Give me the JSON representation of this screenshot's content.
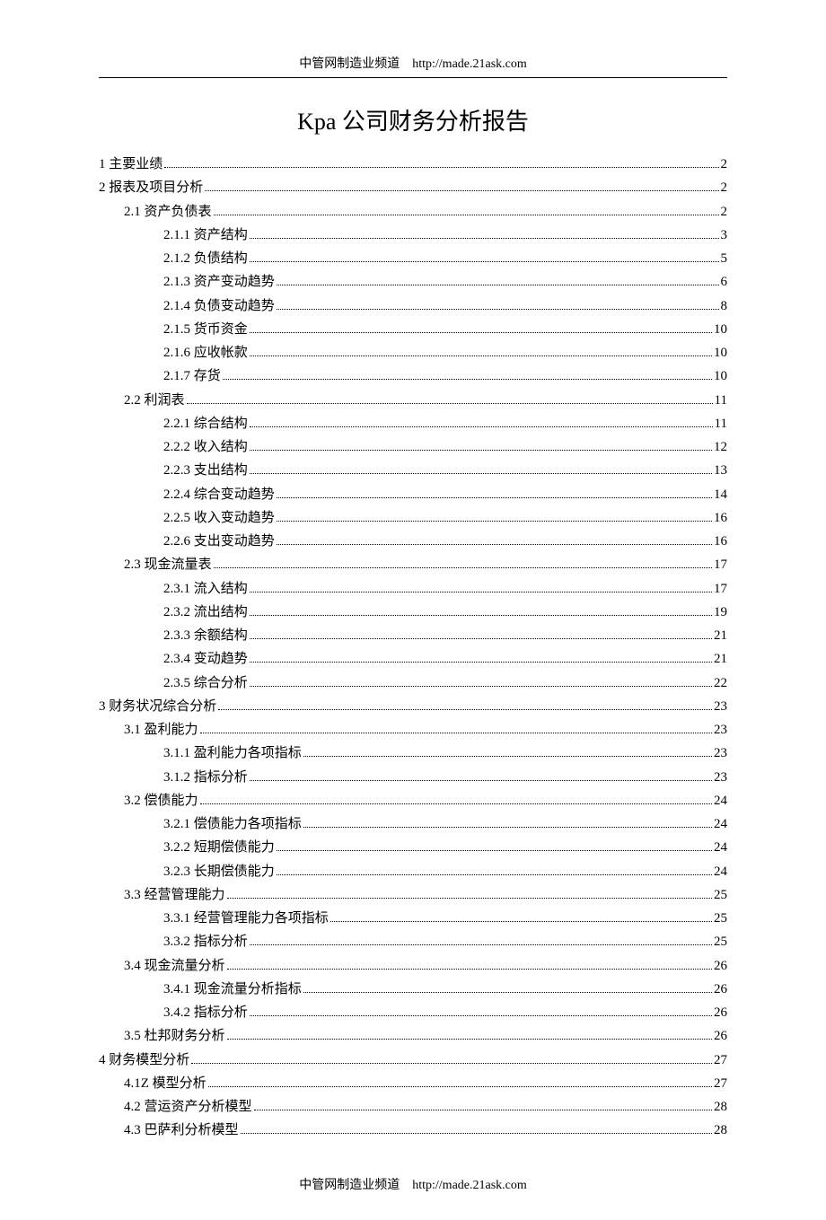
{
  "header": {
    "site_name": "中管网制造业频道",
    "url": "http://made.21ask.com"
  },
  "title": "Kpa 公司财务分析报告",
  "footer": {
    "site_name": "中管网制造业频道",
    "url": "http://made.21ask.com"
  },
  "toc": [
    {
      "label": "1 主要业绩",
      "page": "2",
      "indent": 0
    },
    {
      "label": "2 报表及项目分析",
      "page": "2",
      "indent": 0
    },
    {
      "label": "2.1 资产负债表",
      "page": "2",
      "indent": 1
    },
    {
      "label": "2.1.1 资产结构",
      "page": "3",
      "indent": 2
    },
    {
      "label": "2.1.2 负债结构",
      "page": "5",
      "indent": 2
    },
    {
      "label": "2.1.3 资产变动趋势",
      "page": "6",
      "indent": 2
    },
    {
      "label": "2.1.4 负债变动趋势",
      "page": "8",
      "indent": 2
    },
    {
      "label": "2.1.5 货币资金",
      "page": "10",
      "indent": 2
    },
    {
      "label": "2.1.6 应收帐款",
      "page": "10",
      "indent": 2
    },
    {
      "label": "2.1.7 存货",
      "page": "10",
      "indent": 2
    },
    {
      "label": "2.2 利润表",
      "page": "11",
      "indent": 1
    },
    {
      "label": "2.2.1 综合结构",
      "page": "11",
      "indent": 2
    },
    {
      "label": "2.2.2 收入结构",
      "page": "12",
      "indent": 2
    },
    {
      "label": "2.2.3 支出结构",
      "page": "13",
      "indent": 2
    },
    {
      "label": "2.2.4 综合变动趋势",
      "page": "14",
      "indent": 2
    },
    {
      "label": "2.2.5 收入变动趋势",
      "page": "16",
      "indent": 2
    },
    {
      "label": "2.2.6 支出变动趋势",
      "page": "16",
      "indent": 2
    },
    {
      "label": "2.3 现金流量表",
      "page": "17",
      "indent": 1
    },
    {
      "label": "2.3.1 流入结构",
      "page": "17",
      "indent": 2
    },
    {
      "label": "2.3.2 流出结构",
      "page": "19",
      "indent": 2
    },
    {
      "label": "2.3.3 余额结构",
      "page": "21",
      "indent": 2
    },
    {
      "label": "2.3.4 变动趋势",
      "page": "21",
      "indent": 2
    },
    {
      "label": "2.3.5 综合分析",
      "page": "22",
      "indent": 2
    },
    {
      "label": "3 财务状况综合分析",
      "page": "23",
      "indent": 0
    },
    {
      "label": "3.1 盈利能力",
      "page": "23",
      "indent": 1
    },
    {
      "label": "3.1.1 盈利能力各项指标",
      "page": "23",
      "indent": 2
    },
    {
      "label": "3.1.2 指标分析",
      "page": "23",
      "indent": 2
    },
    {
      "label": "3.2 偿债能力",
      "page": "24",
      "indent": 1
    },
    {
      "label": "3.2.1 偿债能力各项指标",
      "page": "24",
      "indent": 2
    },
    {
      "label": "3.2.2 短期偿债能力",
      "page": "24",
      "indent": 2
    },
    {
      "label": "3.2.3 长期偿债能力",
      "page": "24",
      "indent": 2
    },
    {
      "label": "3.3 经营管理能力",
      "page": "25",
      "indent": 1
    },
    {
      "label": "3.3.1 经营管理能力各项指标",
      "page": "25",
      "indent": 2
    },
    {
      "label": "3.3.2 指标分析",
      "page": "25",
      "indent": 2
    },
    {
      "label": "3.4 现金流量分析",
      "page": "26",
      "indent": 1
    },
    {
      "label": "3.4.1 现金流量分析指标",
      "page": "26",
      "indent": 2
    },
    {
      "label": "3.4.2 指标分析",
      "page": "26",
      "indent": 2
    },
    {
      "label": "3.5 杜邦财务分析",
      "page": "26",
      "indent": 1
    },
    {
      "label": "4 财务模型分析",
      "page": "27",
      "indent": 0
    },
    {
      "label": "4.1Z 模型分析",
      "page": "27",
      "indent": 1
    },
    {
      "label": "4.2 营运资产分析模型",
      "page": "28",
      "indent": 1
    },
    {
      "label": "4.3 巴萨利分析模型",
      "page": "28",
      "indent": 1
    }
  ]
}
